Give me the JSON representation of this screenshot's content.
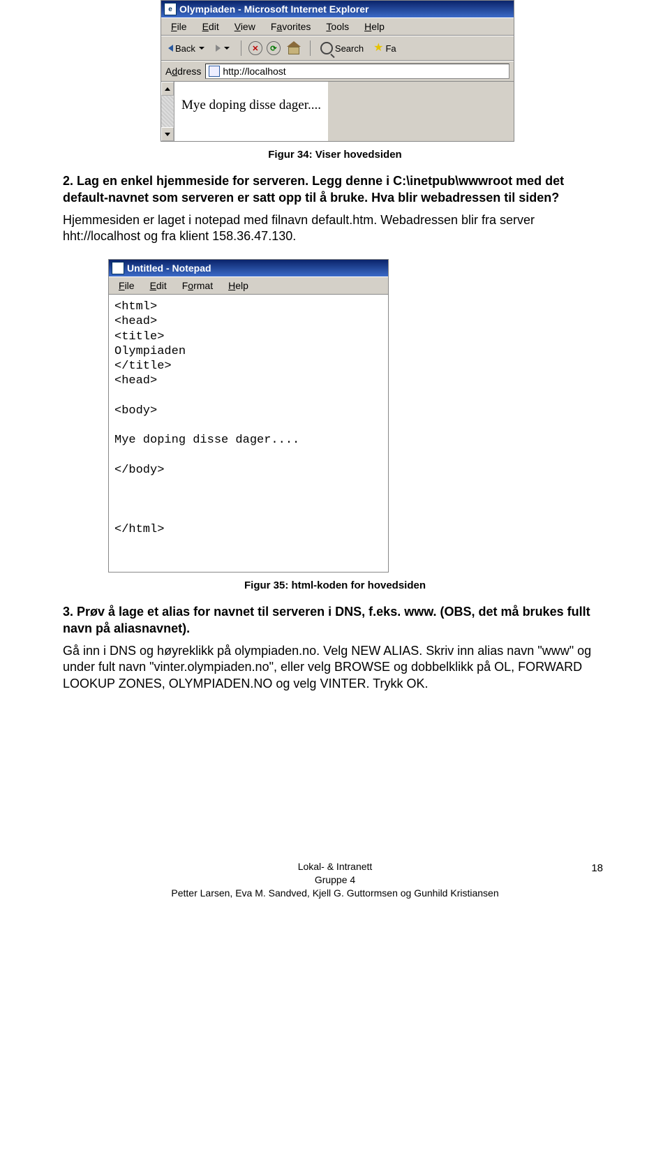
{
  "ie": {
    "title": "Olympiaden - Microsoft Internet Explorer",
    "menu": {
      "file": "File",
      "edit": "Edit",
      "view": "View",
      "favorites": "Favorites",
      "tools": "Tools",
      "help": "Help"
    },
    "toolbar": {
      "back": "Back",
      "search": "Search",
      "favorites_short": "Fa"
    },
    "addr_label": "Address",
    "addr_value": "http://localhost",
    "body_text": "Mye doping disse dager...."
  },
  "fig34": "Figur 34: Viser hovedsiden",
  "q2": {
    "heading": "2. Lag en enkel hjemmeside for serveren. Legg denne i C:\\inetpub\\wwwroot med det default-navnet som serveren er satt opp til å bruke. Hva blir webadressen til siden?",
    "ans": "Hjemmesiden er laget i notepad med filnavn default.htm. Webadressen blir fra server hht://localhost og fra klient 158.36.47.130."
  },
  "np": {
    "title": "Untitled - Notepad",
    "menu": {
      "file": "File",
      "edit": "Edit",
      "format": "Format",
      "help": "Help"
    },
    "code": "<html>\n<head>\n<title>\nOlympiaden\n</title>\n<head>\n\n<body>\n\nMye doping disse dager....\n\n</body>\n\n\n\n</html>"
  },
  "fig35": "Figur 35: html-koden for hovedsiden",
  "q3": {
    "heading": "3. Prøv å lage et alias for navnet til serveren i DNS, f.eks. www. (OBS, det må brukes fullt navn på aliasnavnet).",
    "ans": "Gå inn i DNS og høyreklikk på olympiaden.no. Velg NEW ALIAS. Skriv inn alias navn \"www\" og under fult navn \"vinter.olympiaden.no\", eller velg BROWSE og dobbelklikk på OL, FORWARD LOOKUP ZONES, OLYMPIADEN.NO og velg VINTER. Trykk OK."
  },
  "footer": {
    "l1": "Lokal- & Intranett",
    "l2": "Gruppe 4",
    "l3": "Petter Larsen, Eva M. Sandved, Kjell G. Guttormsen og Gunhild Kristiansen",
    "page": "18"
  }
}
